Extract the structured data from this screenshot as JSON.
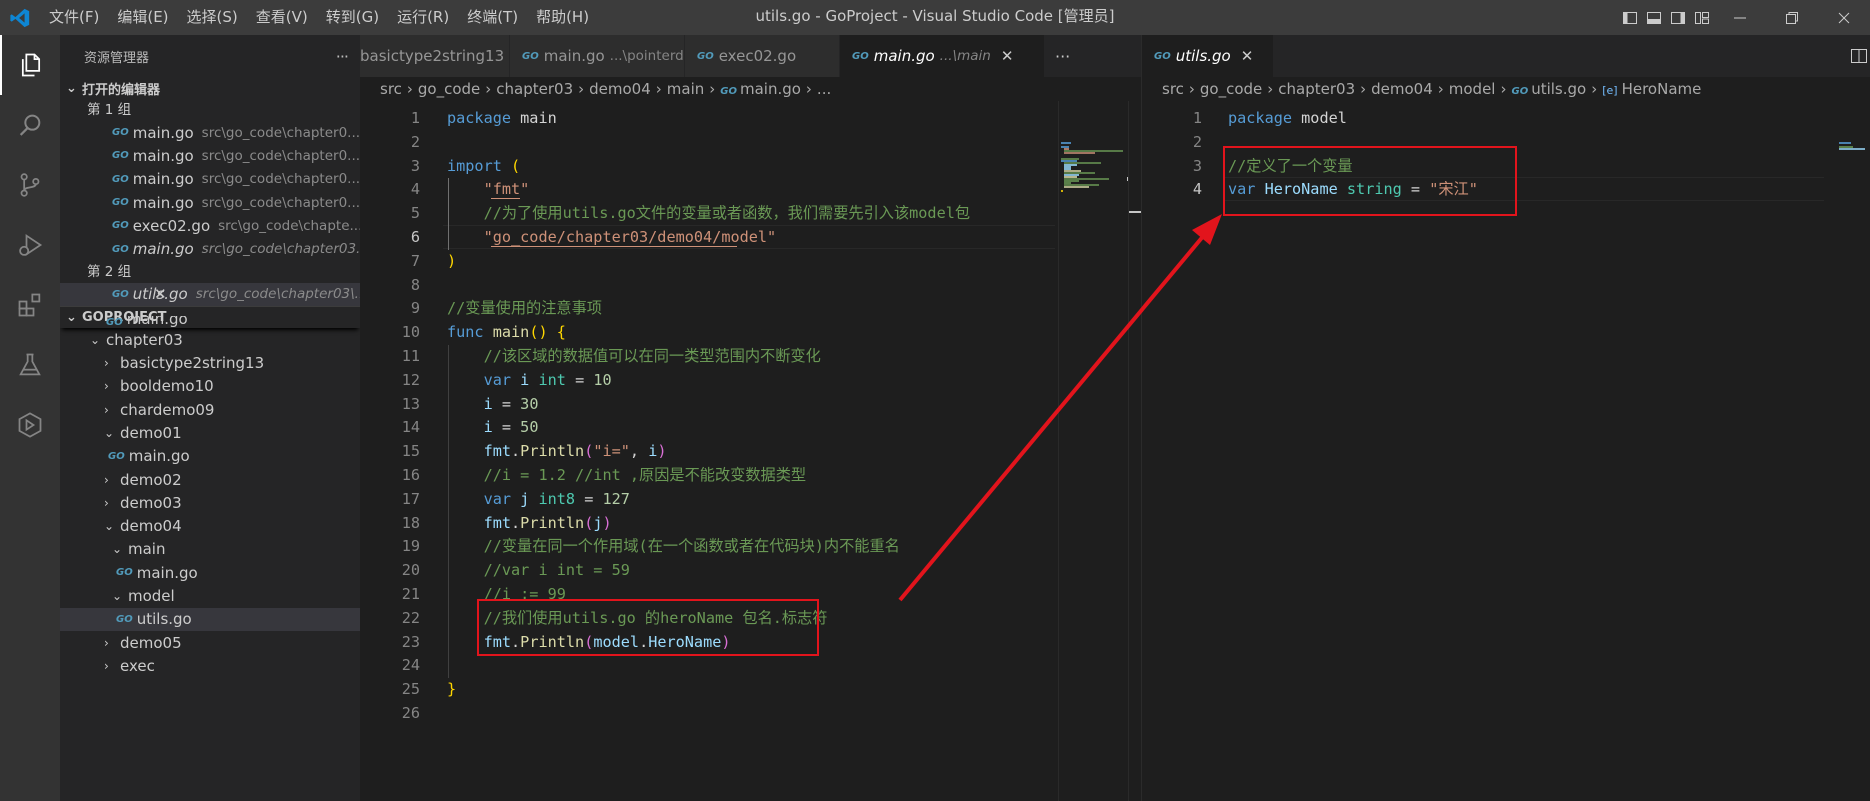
{
  "titlebar": {
    "menu": [
      "文件(F)",
      "编辑(E)",
      "选择(S)",
      "查看(V)",
      "转到(G)",
      "运行(R)",
      "终端(T)",
      "帮助(H)"
    ],
    "title": "utils.go - GoProject - Visual Studio Code [管理员]"
  },
  "activity": [
    "explorer-icon",
    "search-icon",
    "source-control-icon",
    "run-debug-icon",
    "extensions-icon",
    "testing-icon",
    "remote-icon"
  ],
  "sidebar": {
    "header": "资源管理器",
    "more": "···",
    "open_editors_title": "打开的编辑器",
    "group1": "第 1 组",
    "group1_items": [
      {
        "name": "main.go",
        "path": "src\\go_code\\chapter0..."
      },
      {
        "name": "main.go",
        "path": "src\\go_code\\chapter0..."
      },
      {
        "name": "main.go",
        "path": "src\\go_code\\chapter0..."
      },
      {
        "name": "main.go",
        "path": "src\\go_code\\chapter0..."
      },
      {
        "name": "exec02.go",
        "path": "src\\go_code\\chapte..."
      },
      {
        "name": "main.go",
        "path": "src\\go_code\\chapter03..."
      }
    ],
    "group2": "第 2 组",
    "group2_items": [
      {
        "name": "utils.go",
        "path": "src\\go_code\\chapter03\\..."
      }
    ],
    "project_title": "GOPROJECT",
    "tree": [
      {
        "label": "main.go",
        "kind": "file",
        "indent": 46,
        "partial": true
      },
      {
        "label": "chapter03",
        "kind": "open",
        "indent": 30
      },
      {
        "label": "basictype2string13",
        "kind": "closed",
        "indent": 44
      },
      {
        "label": "booldemo10",
        "kind": "closed",
        "indent": 44
      },
      {
        "label": "chardemo09",
        "kind": "closed",
        "indent": 44
      },
      {
        "label": "demo01",
        "kind": "open",
        "indent": 44
      },
      {
        "label": "main.go",
        "kind": "file",
        "indent": 48
      },
      {
        "label": "demo02",
        "kind": "closed",
        "indent": 44
      },
      {
        "label": "demo03",
        "kind": "closed",
        "indent": 44
      },
      {
        "label": "demo04",
        "kind": "open",
        "indent": 44
      },
      {
        "label": "main",
        "kind": "open",
        "indent": 52
      },
      {
        "label": "main.go",
        "kind": "file",
        "indent": 56
      },
      {
        "label": "model",
        "kind": "open",
        "indent": 52
      },
      {
        "label": "utils.go",
        "kind": "file",
        "indent": 56,
        "selected": true
      },
      {
        "label": "demo05",
        "kind": "closed",
        "indent": 44
      },
      {
        "label": "exec",
        "kind": "closed",
        "indent": 44
      }
    ]
  },
  "editor1": {
    "tabs": [
      {
        "name": "basictype2string13",
        "desc": "",
        "go": false,
        "clipped": true
      },
      {
        "name": "main.go",
        "desc": "...\\pointerdemo",
        "go": true
      },
      {
        "name": "exec02.go",
        "desc": "",
        "go": true
      },
      {
        "name": "main.go",
        "desc": "...\\main",
        "go": true,
        "active": true
      }
    ],
    "tab_more": "···",
    "breadcrumb": [
      "src",
      "go_code",
      "chapter03",
      "demo04",
      "main",
      "main.go",
      "..."
    ],
    "current_line": 6,
    "lines": [
      [
        [
          "kw",
          "package"
        ],
        [
          "pl",
          " main"
        ]
      ],
      [],
      [
        [
          "kw",
          "import"
        ],
        [
          "pl",
          " "
        ],
        [
          "br",
          "("
        ]
      ],
      [
        [
          "pl",
          "    "
        ],
        [
          "st",
          "\"fmt\""
        ]
      ],
      [
        [
          "pl",
          "    "
        ],
        [
          "cm",
          "//为了使用utils.go文件的变量或者函数，我们需要先引入该model包"
        ]
      ],
      [
        [
          "pl",
          "    "
        ],
        [
          "st",
          "\"go_code/chapter03/demo04/model\""
        ]
      ],
      [
        [
          "br",
          ")"
        ]
      ],
      [],
      [
        [
          "cm",
          "//变量使用的注意事项"
        ]
      ],
      [
        [
          "kw",
          "func"
        ],
        [
          "pl",
          " "
        ],
        [
          "fn",
          "main"
        ],
        [
          "br",
          "()"
        ],
        [
          "pl",
          " "
        ],
        [
          "br",
          "{"
        ]
      ],
      [
        [
          "pl",
          "    "
        ],
        [
          "cm",
          "//该区域的数据值可以在同一类型范围内不断变化"
        ]
      ],
      [
        [
          "pl",
          "    "
        ],
        [
          "kw",
          "var"
        ],
        [
          "pl",
          " "
        ],
        [
          "vr",
          "i"
        ],
        [
          "pl",
          " "
        ],
        [
          "ty",
          "int"
        ],
        [
          "pl",
          " = "
        ],
        [
          "nm",
          "10"
        ]
      ],
      [
        [
          "pl",
          "    "
        ],
        [
          "vr",
          "i"
        ],
        [
          "pl",
          " = "
        ],
        [
          "nm",
          "30"
        ]
      ],
      [
        [
          "pl",
          "    "
        ],
        [
          "vr",
          "i"
        ],
        [
          "pl",
          " = "
        ],
        [
          "nm",
          "50"
        ]
      ],
      [
        [
          "pl",
          "    "
        ],
        [
          "vr",
          "fmt"
        ],
        [
          "pl",
          "."
        ],
        [
          "fn",
          "Println"
        ],
        [
          "br2",
          "("
        ],
        [
          "st",
          "\"i=\""
        ],
        [
          "pl",
          ", "
        ],
        [
          "vr",
          "i"
        ],
        [
          "br2",
          ")"
        ]
      ],
      [
        [
          "pl",
          "    "
        ],
        [
          "cm",
          "//i = 1.2 //int ,原因是不能改变数据类型"
        ]
      ],
      [
        [
          "pl",
          "    "
        ],
        [
          "kw",
          "var"
        ],
        [
          "pl",
          " "
        ],
        [
          "vr",
          "j"
        ],
        [
          "pl",
          " "
        ],
        [
          "ty",
          "int8"
        ],
        [
          "pl",
          " = "
        ],
        [
          "nm",
          "127"
        ]
      ],
      [
        [
          "pl",
          "    "
        ],
        [
          "vr",
          "fmt"
        ],
        [
          "pl",
          "."
        ],
        [
          "fn",
          "Println"
        ],
        [
          "br2",
          "("
        ],
        [
          "vr",
          "j"
        ],
        [
          "br2",
          ")"
        ]
      ],
      [
        [
          "pl",
          "    "
        ],
        [
          "cm",
          "//变量在同一个作用域(在一个函数或者在代码块)内不能重名"
        ]
      ],
      [
        [
          "pl",
          "    "
        ],
        [
          "cm",
          "//var i int = 59"
        ]
      ],
      [
        [
          "pl",
          "    "
        ],
        [
          "cm",
          "//i := 99"
        ]
      ],
      [
        [
          "pl",
          "    "
        ],
        [
          "cm",
          "//我们使用utils.go 的heroName 包名.标志符"
        ]
      ],
      [
        [
          "pl",
          "    "
        ],
        [
          "vr",
          "fmt"
        ],
        [
          "pl",
          "."
        ],
        [
          "fn",
          "Println"
        ],
        [
          "br2",
          "("
        ],
        [
          "vr",
          "model"
        ],
        [
          "pl",
          "."
        ],
        [
          "vr",
          "HeroName"
        ],
        [
          "br2",
          ")"
        ]
      ],
      [],
      [
        [
          "br",
          "}"
        ]
      ],
      []
    ]
  },
  "editor2": {
    "tabs": [
      {
        "name": "utils.go",
        "desc": "",
        "go": true,
        "active": true
      }
    ],
    "breadcrumb": [
      "src",
      "go_code",
      "chapter03",
      "demo04",
      "model",
      "utils.go",
      "HeroName"
    ],
    "current_line": 4,
    "lines": [
      [
        [
          "kw",
          "package"
        ],
        [
          "pl",
          " model"
        ]
      ],
      [],
      [
        [
          "cm",
          "//定义了一个变量"
        ]
      ],
      [
        [
          "kw",
          "var"
        ],
        [
          "pl",
          " "
        ],
        [
          "vr",
          "HeroName"
        ],
        [
          "pl",
          " "
        ],
        [
          "ty",
          "string"
        ],
        [
          "pl",
          " = "
        ],
        [
          "st",
          "\"宋江\""
        ]
      ]
    ]
  },
  "colors": {
    "annotation": "#e2141c",
    "go_icon": "#519aba"
  }
}
